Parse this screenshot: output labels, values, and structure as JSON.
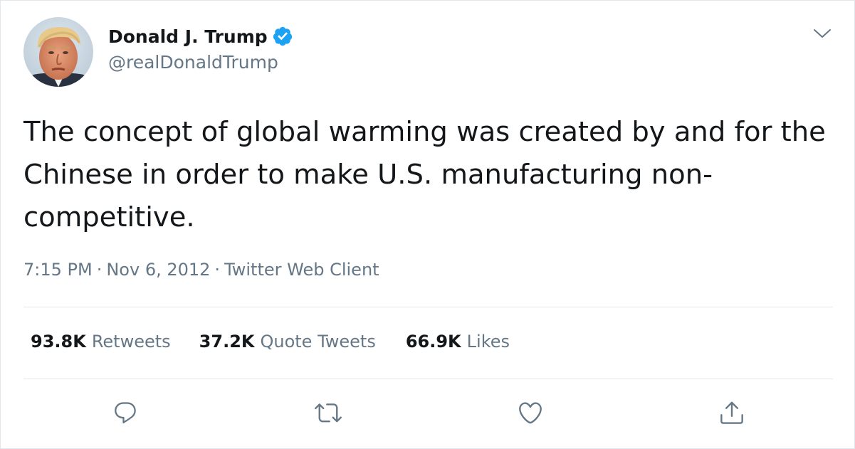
{
  "author": {
    "display_name": "Donald J. Trump",
    "handle": "@realDonaldTrump",
    "verified_icon": "verified-badge-icon"
  },
  "tweet": {
    "text": "The concept of global warming was created by and for the Chinese in order to make U.S. manufacturing non-competitive.",
    "time": "7:15 PM",
    "date": "Nov 6, 2012",
    "source": "Twitter Web Client",
    "separator": "·"
  },
  "stats": {
    "retweets_count": "93.8K",
    "retweets_label": "Retweets",
    "quotes_count": "37.2K",
    "quotes_label": "Quote Tweets",
    "likes_count": "66.9K",
    "likes_label": "Likes"
  },
  "actions": [
    "reply-icon",
    "retweet-icon",
    "like-icon",
    "share-icon"
  ],
  "colors": {
    "text_primary": "#14171a",
    "text_secondary": "#657786",
    "divider": "#e1e8ed",
    "verified": "#1da1f2"
  }
}
